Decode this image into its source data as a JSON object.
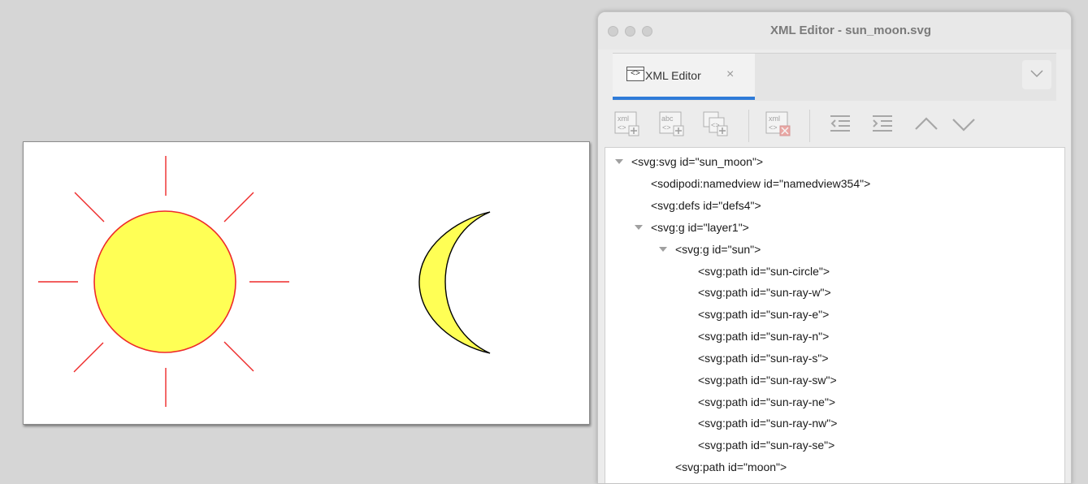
{
  "window": {
    "title": "XML Editor - sun_moon.svg"
  },
  "tabs": {
    "active_label": "XML Editor",
    "icon_glyph": "<>",
    "close_glyph": "×",
    "menu_glyph": "﹀"
  },
  "toolbar": {
    "buttons": [
      {
        "name": "new-element-node-icon",
        "label": "xml"
      },
      {
        "name": "new-text-node-icon",
        "label": "abc"
      },
      {
        "name": "duplicate-node-icon",
        "label": "<>"
      },
      {
        "name": "delete-node-icon",
        "label": "xml"
      },
      {
        "name": "unindent-node-icon",
        "label": ""
      },
      {
        "name": "indent-node-icon",
        "label": ""
      },
      {
        "name": "raise-node-icon",
        "label": ""
      },
      {
        "name": "lower-node-icon",
        "label": ""
      }
    ]
  },
  "tree": {
    "rows": [
      {
        "text": "<svg:svg id=\"sun_moon\">",
        "expandable": true
      },
      {
        "text": "<sodipodi:namedview id=\"namedview354\">",
        "expandable": false
      },
      {
        "text": "<svg:defs id=\"defs4\">",
        "expandable": false
      },
      {
        "text": "<svg:g id=\"layer1\">",
        "expandable": true
      },
      {
        "text": "<svg:g id=\"sun\">",
        "expandable": true
      },
      {
        "text": "<svg:path id=\"sun-circle\">",
        "expandable": false
      },
      {
        "text": "<svg:path id=\"sun-ray-w\">",
        "expandable": false
      },
      {
        "text": "<svg:path id=\"sun-ray-e\">",
        "expandable": false
      },
      {
        "text": "<svg:path id=\"sun-ray-n\">",
        "expandable": false
      },
      {
        "text": "<svg:path id=\"sun-ray-s\">",
        "expandable": false
      },
      {
        "text": "<svg:path id=\"sun-ray-sw\">",
        "expandable": false
      },
      {
        "text": "<svg:path id=\"sun-ray-ne\">",
        "expandable": false
      },
      {
        "text": "<svg:path id=\"sun-ray-nw\">",
        "expandable": false
      },
      {
        "text": "<svg:path id=\"sun-ray-se\">",
        "expandable": false
      },
      {
        "text": "<svg:path id=\"moon\">",
        "expandable": false
      }
    ]
  },
  "colors": {
    "sun_fill": "#ffff55",
    "sun_stroke": "#ee2a2a",
    "moon_fill": "#ffff55",
    "moon_stroke": "#000000",
    "accent": "#2f7bd8"
  }
}
